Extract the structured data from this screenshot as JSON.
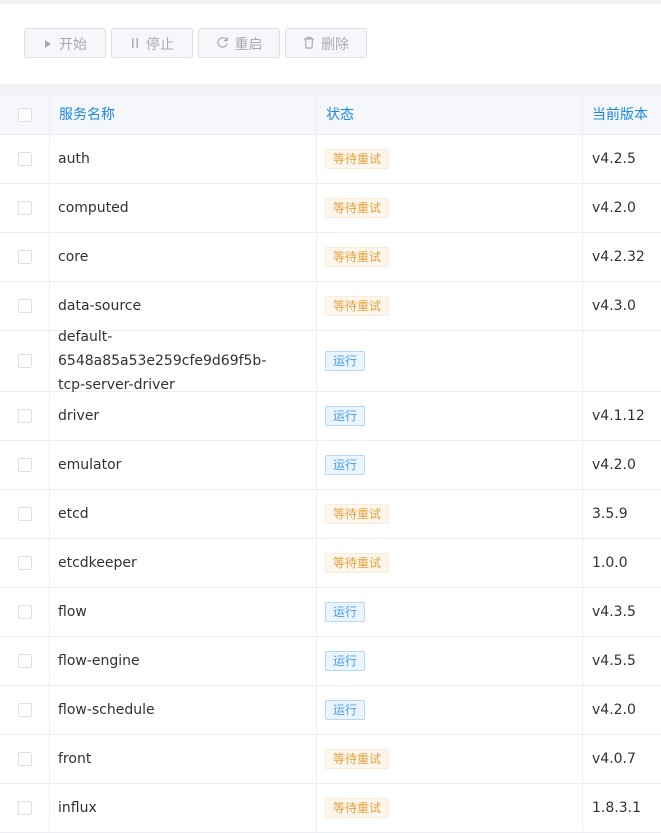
{
  "toolbar": {
    "buttons": [
      {
        "label": "开始",
        "icon": "play-icon"
      },
      {
        "label": "停止",
        "icon": "pause-icon"
      },
      {
        "label": "重启",
        "icon": "refresh-icon"
      },
      {
        "label": "删除",
        "icon": "trash-icon"
      }
    ]
  },
  "table": {
    "columns": [
      "服务名称",
      "状态",
      "当前版本"
    ],
    "rows": [
      {
        "name": "auth",
        "status": "等待重试",
        "status_type": "warning",
        "version": "v4.2.5"
      },
      {
        "name": "computed",
        "status": "等待重试",
        "status_type": "warning",
        "version": "v4.2.0"
      },
      {
        "name": "core",
        "status": "等待重试",
        "status_type": "warning",
        "version": "v4.2.32"
      },
      {
        "name": "data-source",
        "status": "等待重试",
        "status_type": "warning",
        "version": "v4.3.0"
      },
      {
        "name": "default-6548a85a53e259cfe9d69f5b-tcp-server-driver",
        "name_lines": [
          "default-6548a85a53e259cfe9d69f5b-",
          "tcp-server-driver"
        ],
        "status": "运行",
        "status_type": "running",
        "version": ""
      },
      {
        "name": "driver",
        "status": "运行",
        "status_type": "running",
        "version": "v4.1.12"
      },
      {
        "name": "emulator",
        "status": "运行",
        "status_type": "running",
        "version": "v4.2.0"
      },
      {
        "name": "etcd",
        "status": "等待重试",
        "status_type": "warning",
        "version": "3.5.9"
      },
      {
        "name": "etcdkeeper",
        "status": "等待重试",
        "status_type": "warning",
        "version": "1.0.0"
      },
      {
        "name": "flow",
        "status": "运行",
        "status_type": "running",
        "version": "v4.3.5"
      },
      {
        "name": "flow-engine",
        "status": "运行",
        "status_type": "running",
        "version": "v4.5.5"
      },
      {
        "name": "flow-schedule",
        "status": "运行",
        "status_type": "running",
        "version": "v4.2.0"
      },
      {
        "name": "front",
        "status": "等待重试",
        "status_type": "warning",
        "version": "v4.0.7"
      },
      {
        "name": "influx",
        "status": "等待重试",
        "status_type": "warning",
        "version": "1.8.3.1"
      }
    ]
  },
  "colors": {
    "header_text": "#1e88e5",
    "warning_tag": "#e6a23c",
    "running_tag": "#409eff"
  }
}
